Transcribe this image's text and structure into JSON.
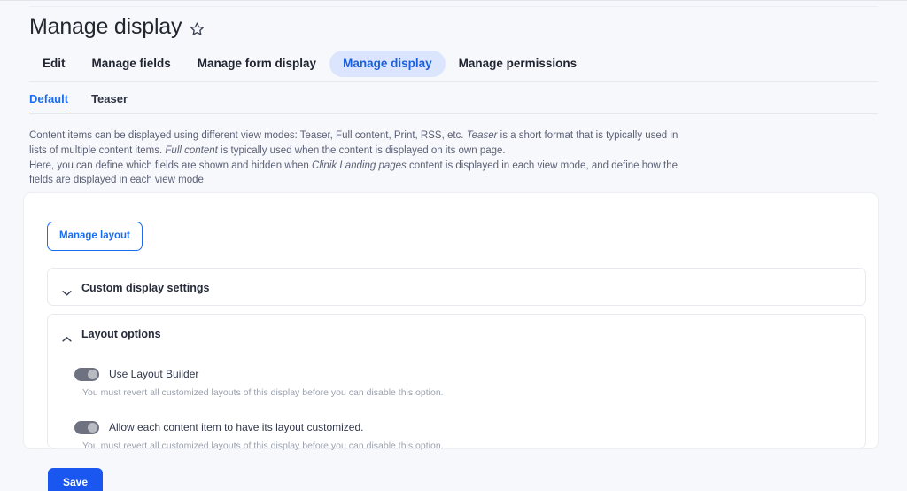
{
  "header": {
    "title": "Manage display",
    "favorite_icon": "star-icon"
  },
  "primary_tabs": [
    {
      "label": "Edit",
      "active": false
    },
    {
      "label": "Manage fields",
      "active": false
    },
    {
      "label": "Manage form display",
      "active": false
    },
    {
      "label": "Manage display",
      "active": true
    },
    {
      "label": "Manage permissions",
      "active": false
    }
  ],
  "secondary_tabs": [
    {
      "label": "Default",
      "active": true
    },
    {
      "label": "Teaser",
      "active": false
    }
  ],
  "description": {
    "line1_a": "Content items can be displayed using different view modes: Teaser, Full content, Print, RSS, etc. ",
    "line1_em1": "Teaser",
    "line1_b": " is a short format that is typically used in lists of multiple content items. ",
    "line1_em2": "Full content",
    "line1_c": " is typically used when the content is displayed on its own page.",
    "line2_a": "Here, you can define which fields are shown and hidden when ",
    "line2_em1": "Clinik Landing pages",
    "line2_b": " content is displayed in each view mode, and define how the fields are displayed in each view mode."
  },
  "card": {
    "manage_layout_label": "Manage layout",
    "panels": [
      {
        "title": "Custom display settings",
        "expanded": false,
        "chevron": "chevron-down-icon"
      },
      {
        "title": "Layout options",
        "expanded": true,
        "chevron": "chevron-up-icon"
      }
    ],
    "layout_options": [
      {
        "label": "Use Layout Builder",
        "help": "You must revert all customized layouts of this display before you can disable this option.",
        "state": "off"
      },
      {
        "label": "Allow each content item to have its layout customized.",
        "help": "You must revert all customized layouts of this display before you can disable this option.",
        "state": "off"
      }
    ]
  },
  "actions": {
    "save_label": "Save"
  },
  "colors": {
    "accent_blue": "#1a6cf0",
    "primary_button": "#1a56f0",
    "active_pill_bg": "#dbe6fe",
    "page_bg": "#f7f8fc",
    "card_bg": "#ffffff",
    "toggle_track": "#6e7280",
    "toggle_knob": "#b9bbc3"
  }
}
